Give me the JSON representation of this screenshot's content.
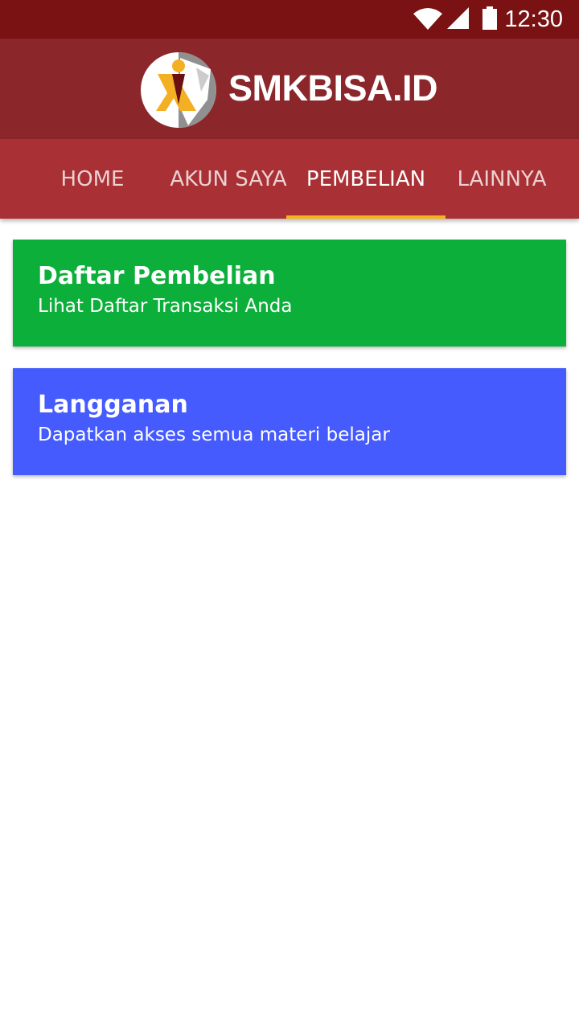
{
  "status_bar": {
    "time": "12:30",
    "icons": [
      "wifi-icon",
      "signal-icon",
      "battery-icon"
    ]
  },
  "header": {
    "logo_text": "SMKBISA.ID",
    "logo_icon": "smkbisa-logo-icon"
  },
  "tabs": [
    {
      "label": "HOME",
      "active": false
    },
    {
      "label": "AKUN SAYA",
      "active": false
    },
    {
      "label": "PEMBELIAN",
      "active": true
    },
    {
      "label": "LAINNYA",
      "active": false
    }
  ],
  "cards": [
    {
      "title": "Daftar Pembelian",
      "subtitle": "Lihat Daftar Transaksi Anda",
      "color": "#0caf3a"
    },
    {
      "title": "Langganan",
      "subtitle": "Dapatkan akses semua materi belajar",
      "color": "#455bfe"
    }
  ],
  "colors": {
    "status_bar": "#7a1214",
    "header": "#8b272b",
    "tab_bar": "#a93034",
    "tab_indicator": "#f5b21b"
  }
}
